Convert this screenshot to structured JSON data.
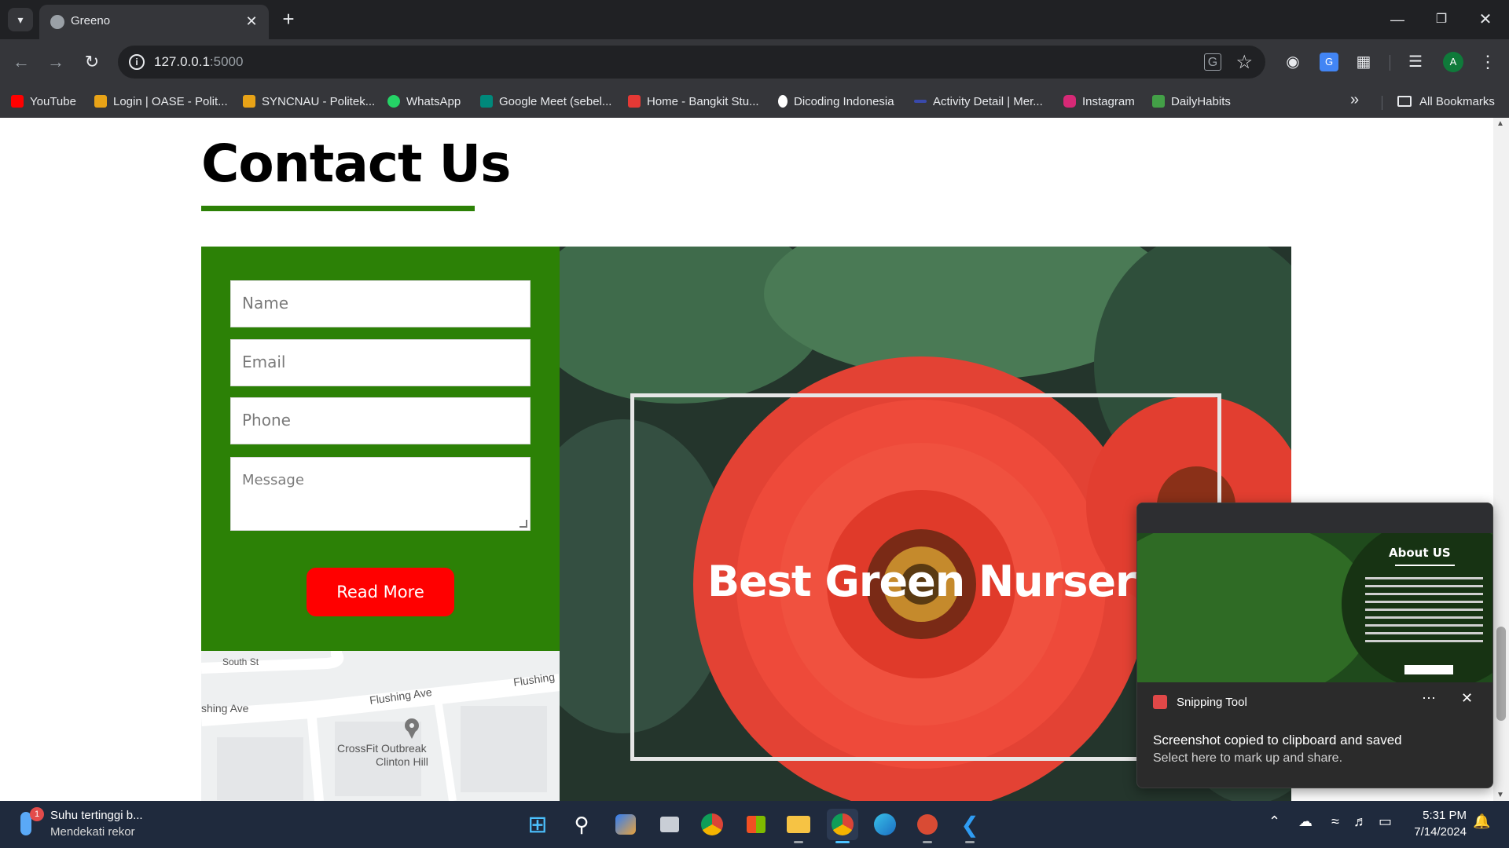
{
  "browser": {
    "tab_title": "Greeno",
    "url_host": "127.0.0.1",
    "url_port": ":5000",
    "bookmarks": [
      {
        "label": "YouTube",
        "color": "#ff0000"
      },
      {
        "label": "Login | OASE - Polit...",
        "color": "#e8a317"
      },
      {
        "label": "SYNCNAU - Politek...",
        "color": "#e8a317"
      },
      {
        "label": "WhatsApp",
        "color": "#25d366"
      },
      {
        "label": "Google Meet (sebel...",
        "color": "#00897b"
      },
      {
        "label": "Home - Bangkit Stu...",
        "color": "#e53935"
      },
      {
        "label": "Dicoding Indonesia",
        "color": "#ffffff"
      },
      {
        "label": "Activity Detail | Mer...",
        "color": "#3949ab"
      },
      {
        "label": "Instagram",
        "color": "#d62976"
      },
      {
        "label": "DailyHabits",
        "color": "#43a047"
      }
    ],
    "all_bookmarks_label": "All Bookmarks",
    "profile_initial": "A"
  },
  "page": {
    "heading": "Contact Us",
    "form": {
      "name_placeholder": "Name",
      "email_placeholder": "Email",
      "phone_placeholder": "Phone",
      "message_placeholder": "Message",
      "submit_label": "Read More"
    },
    "map": {
      "labels": [
        "South St",
        "Flushing Ave",
        "Flushing",
        "shing Ave",
        "CrossFit Outbreak",
        "Clinton Hill"
      ]
    },
    "hero_title": "Best Green Nursery",
    "accent_color": "#2c8106",
    "button_color": "#ff0000"
  },
  "notification": {
    "app_name": "Snipping Tool",
    "title": "Screenshot copied to clipboard and saved",
    "body": "Select here to mark up and share.",
    "thumbnail_heading": "About US"
  },
  "taskbar": {
    "weather_badge": "1",
    "weather_line1": "Suhu tertinggi b...",
    "weather_line2": "Mendekati rekor",
    "time": "5:31 PM",
    "date": "7/14/2024"
  }
}
